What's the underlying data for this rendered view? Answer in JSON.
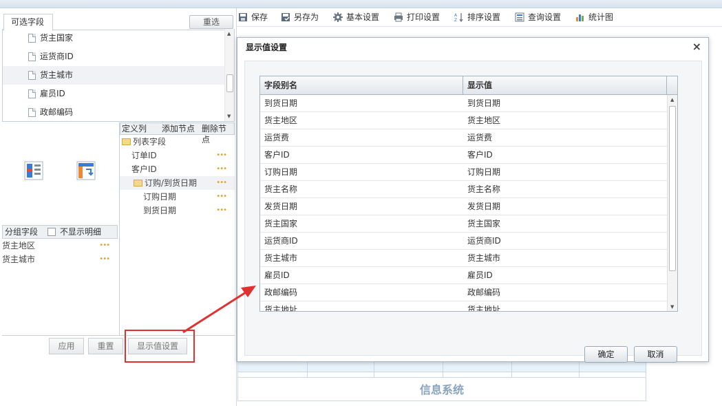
{
  "left_panel": {
    "tab_label": "可选字段",
    "reselect_label": "重选",
    "available_fields": [
      "货主国家",
      "运货商ID",
      "货主城市",
      "雇员ID",
      "政邮编码"
    ],
    "mid_header": {
      "define": "定义列",
      "add": "添加节点",
      "delete": "删除节点"
    },
    "tree": {
      "root": "列表字段",
      "items": [
        "订单ID",
        "客户ID"
      ],
      "group": "订购/到货日期",
      "sub_items": [
        "订购日期",
        "到货日期"
      ]
    },
    "group_section": {
      "label": "分组字段",
      "hide_detail_label": "不显示明细",
      "items": [
        "货主地区",
        "货主城市"
      ]
    },
    "buttons": {
      "apply": "应用",
      "reset": "重置",
      "display_settings": "显示值设置"
    }
  },
  "toolbar": {
    "items": [
      {
        "label": "保存",
        "icon": "floppy-icon"
      },
      {
        "label": "另存为",
        "icon": "save-as-icon"
      },
      {
        "label": "基本设置",
        "icon": "gear-icon"
      },
      {
        "label": "打印设置",
        "icon": "printer-icon"
      },
      {
        "label": "排序设置",
        "icon": "sort-az-icon"
      },
      {
        "label": "查询设置",
        "icon": "query-icon"
      },
      {
        "label": "统计图",
        "icon": "bar-chart-icon"
      }
    ]
  },
  "report": {
    "title": "信息系统"
  },
  "dialog": {
    "title": "显示值设置",
    "close": "×",
    "columns": [
      "字段别名",
      "显示值"
    ],
    "rows": [
      [
        "到货日期",
        "到货日期"
      ],
      [
        "货主地区",
        "货主地区"
      ],
      [
        "运货费",
        "运货费"
      ],
      [
        "客户ID",
        "客户ID"
      ],
      [
        "订购日期",
        "订购日期"
      ],
      [
        "货主名称",
        "货主名称"
      ],
      [
        "发货日期",
        "发货日期"
      ],
      [
        "货主国家",
        "货主国家"
      ],
      [
        "运货商ID",
        "运货商ID"
      ],
      [
        "货主城市",
        "货主城市"
      ],
      [
        "雇员ID",
        "雇员ID"
      ],
      [
        "政邮编码",
        "政邮编码"
      ],
      [
        "货主地址",
        "货主地址"
      ]
    ],
    "ok_label": "确定",
    "cancel_label": "取消"
  }
}
